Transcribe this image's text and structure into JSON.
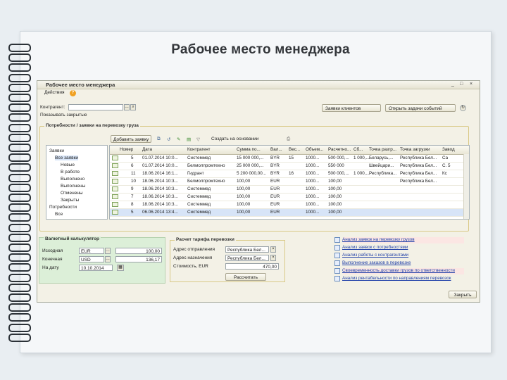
{
  "slide": {
    "title": "Рабочее место менеджера"
  },
  "window": {
    "title": "Рабочее место менеджера",
    "controls": [
      "_",
      "□",
      "×"
    ],
    "menu_label": "Действия",
    "help_icon": "help-icon"
  },
  "filters": {
    "contractor_label": "Контрагент:",
    "contractor_value": "",
    "show_closed_label": "Показывать закрытые",
    "btn_requests": "Заявки клиентов",
    "btn_open_events": "Открыть задачи событий"
  },
  "needs_group": {
    "title": "Потребности / заявки на перевозку груза",
    "add_request": "Добавить заявку",
    "create_based": "Создать на основании",
    "tree": [
      {
        "label": "Заявки",
        "level": 0,
        "expanded": true
      },
      {
        "label": "Все заявки",
        "level": 1,
        "selected": true
      },
      {
        "label": "Новые",
        "level": 2
      },
      {
        "label": "В работе",
        "level": 2
      },
      {
        "label": "Выполнено",
        "level": 2
      },
      {
        "label": "Выполнены",
        "level": 2
      },
      {
        "label": "Отменены",
        "level": 2
      },
      {
        "label": "Закрыты",
        "level": 2
      },
      {
        "label": "Потребности",
        "level": 0
      },
      {
        "label": "Все",
        "level": 1
      }
    ],
    "columns": [
      "Номер",
      "Дата",
      "Контрагент",
      "Сумма по...",
      "Вал...",
      "Вес...",
      "Объем...",
      "Расчетно...",
      "Сб...",
      "Точка разгр...",
      "Точка загрузки",
      "Завод"
    ],
    "rows": [
      {
        "num": "5",
        "date": "01.07.2014 10:0...",
        "contractor": "Системмед",
        "sum": "15 000 000,...",
        "cur": "BYR",
        "w": "15",
        "vol": "1000...",
        "calc": "500 000,...",
        "sb": "1 000,...",
        "unload": "Беларусь,...",
        "load": "Республика Бел...",
        "plant": "Са"
      },
      {
        "num": "6",
        "date": "01.07.2014 10:0...",
        "contractor": "Белмолпромтехно",
        "sum": "25 000 000,...",
        "cur": "BYR",
        "w": "",
        "vol": "1000...",
        "calc": "550 000",
        "sb": "",
        "unload": "Швейцари...",
        "load": "Республика Бел...",
        "plant": "С. 5"
      },
      {
        "num": "11",
        "date": "18.06.2014 16:1...",
        "contractor": "Гидрант",
        "sum": "5 200 000,00...",
        "cur": "BYR",
        "w": "16",
        "vol": "1000...",
        "calc": "500 000,...",
        "sb": "1 000,...",
        "unload": "Республика...",
        "load": "Республика Бел...",
        "plant": "Кс"
      },
      {
        "num": "10",
        "date": "18.06.2014 10:3...",
        "contractor": "Белмолпромтехно",
        "sum": "100,00",
        "cur": "EUR",
        "w": "",
        "vol": "1000...",
        "calc": "100,00",
        "sb": "",
        "unload": "",
        "load": "Республика Бел...",
        "plant": ""
      },
      {
        "num": "9",
        "date": "18.06.2014 10:3...",
        "contractor": "Системмед",
        "sum": "100,00",
        "cur": "EUR",
        "w": "",
        "vol": "1000...",
        "calc": "100,00",
        "sb": "",
        "unload": "",
        "load": "",
        "plant": ""
      },
      {
        "num": "7",
        "date": "18.06.2014 10:3...",
        "contractor": "Системмед",
        "sum": "100,00",
        "cur": "EUR",
        "w": "",
        "vol": "1000...",
        "calc": "100,00",
        "sb": "",
        "unload": "",
        "load": "",
        "plant": ""
      },
      {
        "num": "8",
        "date": "18.06.2014 10:3...",
        "contractor": "Системмед",
        "sum": "100,00",
        "cur": "EUR",
        "w": "",
        "vol": "1000...",
        "calc": "100,00",
        "sb": "",
        "unload": "",
        "load": "",
        "plant": ""
      },
      {
        "num": "5",
        "date": "06.06.2014 13:4...",
        "contractor": "Системмед",
        "sum": "100,00",
        "cur": "EUR",
        "w": "",
        "vol": "1000...",
        "calc": "100,00",
        "sb": "",
        "unload": "",
        "load": "",
        "plant": ""
      }
    ]
  },
  "calc": {
    "title": "Валютный калькулятор",
    "rows": [
      {
        "label": "Исходная",
        "currency": "EUR",
        "amount": "100,00"
      },
      {
        "label": "Конечная",
        "currency": "USD",
        "amount": "136,17"
      },
      {
        "label": "На дату",
        "currency": "10.10.2014",
        "amount": ""
      }
    ]
  },
  "tariff": {
    "title": "Расчет тарифа перевозки",
    "rows": [
      {
        "label": "Адрес отправления",
        "value": "Республика Бел..."
      },
      {
        "label": "Адрес назначения",
        "value": "Республика Бел..."
      },
      {
        "label": "Стоимость, EUR",
        "value": "470,00"
      }
    ],
    "calc_button": "Рассчитать"
  },
  "reports": [
    "Анализ заявок на перевозку грузов",
    "Анализ заявок с потребностями",
    "Анализ работы с контрагентами",
    "Выполнение заказов в перевозке",
    "Своевременность доставки грузов по ответственности",
    "Анализ рентабельности по направлениям перевозок"
  ],
  "footer": {
    "close": "Закрыть"
  }
}
